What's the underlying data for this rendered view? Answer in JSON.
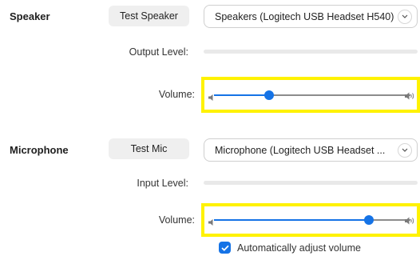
{
  "speaker": {
    "label": "Speaker",
    "test_button": "Test Speaker",
    "device": "Speakers (Logitech USB Headset H540)",
    "output_level_label": "Output Level:",
    "volume_label": "Volume:",
    "volume": 0.28
  },
  "microphone": {
    "label": "Microphone",
    "test_button": "Test Mic",
    "device": "Microphone (Logitech USB Headset ...",
    "input_level_label": "Input Level:",
    "volume_label": "Volume:",
    "volume": 0.79
  },
  "auto_adjust": {
    "label": "Automatically adjust volume",
    "checked": true
  },
  "colors": {
    "accent": "#1573e6",
    "highlight": "#fff200"
  },
  "icons": {
    "volume_low": "speaker-low-icon",
    "volume_high": "speaker-high-icon",
    "dropdown": "chevron-down-icon",
    "check": "checkmark-icon"
  }
}
